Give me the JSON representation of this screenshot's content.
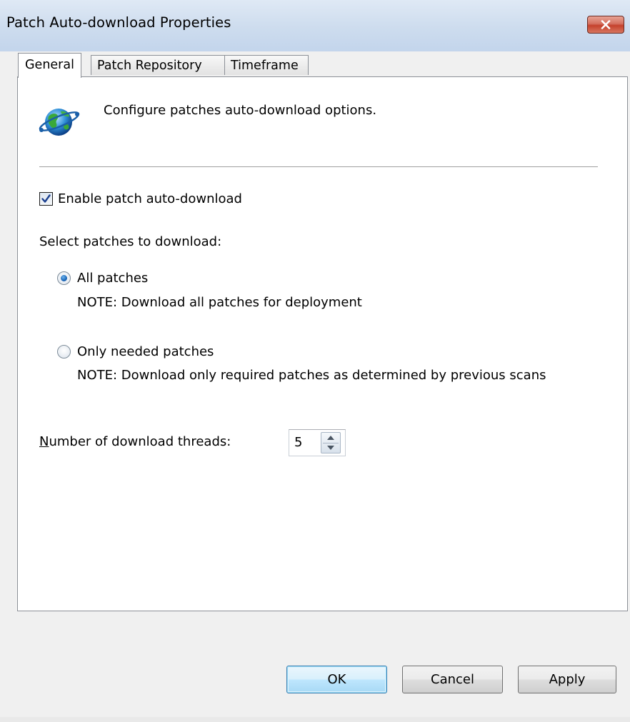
{
  "window": {
    "title": "Patch Auto-download Properties",
    "close_icon": "close-x-icon"
  },
  "tabs": [
    {
      "label": "General",
      "active": true
    },
    {
      "label": "Patch Repository",
      "active": false
    },
    {
      "label": "Timeframe",
      "active": false
    }
  ],
  "general": {
    "header_icon": "globe-network-icon",
    "intro_text": "Configure patches auto-download options.",
    "enable_checkbox": {
      "label": "Enable patch auto-download",
      "checked": true
    },
    "select_label": "Select patches to download:",
    "options": [
      {
        "label": "All patches",
        "note": "NOTE: Download all patches for deployment",
        "selected": true
      },
      {
        "label": "Only needed patches",
        "note": "NOTE: Download only required patches as determined by previous scans",
        "selected": false
      }
    ],
    "threads": {
      "label_mnemonic": "N",
      "label_rest": "umber of download threads:",
      "value": "5"
    }
  },
  "buttons": {
    "ok": "OK",
    "cancel": "Cancel",
    "apply": "Apply"
  },
  "colors": {
    "title_bar": "#cddcee",
    "close_button": "#c5412c",
    "default_button_border": "#3c7fb1",
    "radio_selected": "#1a66b8"
  }
}
